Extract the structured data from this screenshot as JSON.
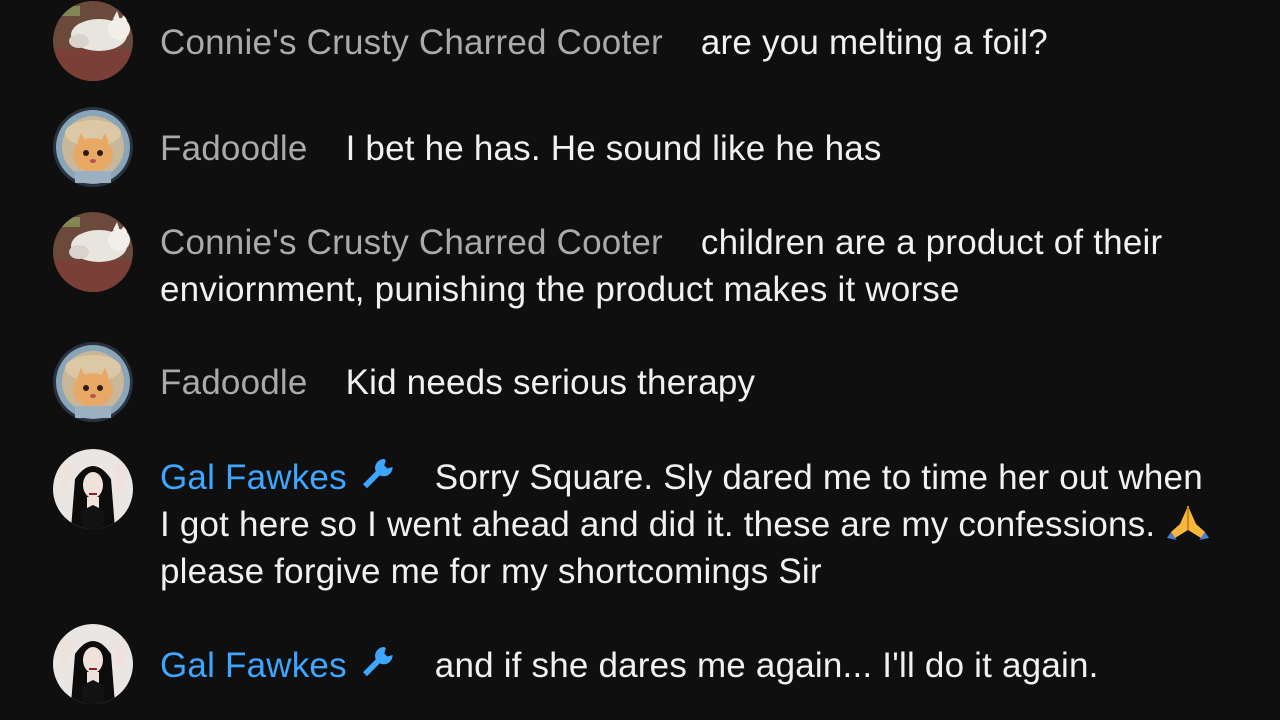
{
  "chat": {
    "messages": [
      {
        "author": "Connie's Crusty Charred Cooter",
        "avatar": "cat-photo-avatar",
        "text": "are you melting a foil?"
      },
      {
        "author": "Fadoodle",
        "avatar": "astronaut-cat-avatar",
        "text": "I bet he has. He sound like he has"
      },
      {
        "author": "Connie's Crusty Charred Cooter",
        "avatar": "cat-photo-avatar",
        "text": "children are a product of their enviornment, punishing the product makes it worse"
      },
      {
        "author": "Fadoodle",
        "avatar": "astronaut-cat-avatar",
        "text": "Kid needs serious therapy"
      },
      {
        "author": "Gal Fawkes",
        "avatar": "gothic-woman-avatar",
        "badge": "wrench-icon",
        "text_before_emoji": "Sorry Square. Sly dared me to time her out when I got here so I went ahead and did it. these are my confessions. ",
        "emoji": "folded-hands-emoji",
        "text_after_emoji": "please forgive me for my shortcomings Sir"
      },
      {
        "author": "Gal Fawkes",
        "avatar": "gothic-woman-avatar",
        "badge": "wrench-icon",
        "text": "and if she dares me again... I'll do it again."
      }
    ]
  },
  "colors": {
    "background": "#0f0f0f",
    "author_name": "#aaaaaa",
    "moderator_name": "#3ea6ff",
    "message_text": "#f1f1f1"
  }
}
